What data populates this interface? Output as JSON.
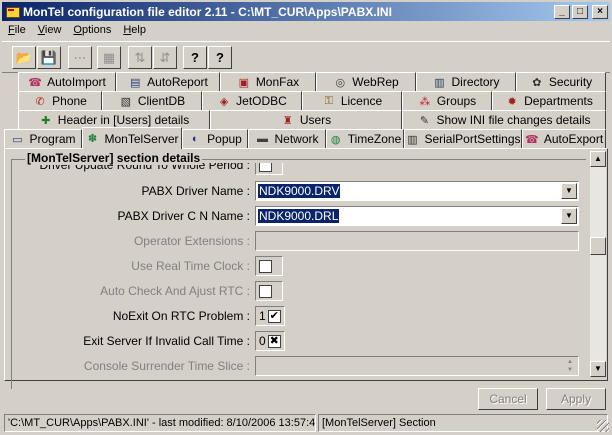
{
  "window": {
    "title": "MonTel configuration file editor 2.11  -  C:\\MT_CUR\\Apps\\PABX.INI",
    "min": "_",
    "max": "□",
    "close": "×"
  },
  "menu": [
    {
      "label": "File",
      "key": "F",
      "rest": "ile"
    },
    {
      "label": "View",
      "key": "V",
      "rest": "iew"
    },
    {
      "label": "Options",
      "key": "O",
      "rest": "ptions"
    },
    {
      "label": "Help",
      "key": "H",
      "rest": "elp"
    }
  ],
  "toolbar": {
    "open": "📂",
    "save": "💾",
    "tb3": "⋯",
    "tb4": "▦",
    "tb5": "⇅",
    "tb6": "⇵",
    "help": "?",
    "help_cursor": "?"
  },
  "tabs": {
    "row1": [
      {
        "label": "AutoImport",
        "icon": "tab-autoimport-icon",
        "glyph": "☎"
      },
      {
        "label": "AutoReport",
        "icon": "tab-autoreport-icon",
        "glyph": "▤"
      },
      {
        "label": "MonFax",
        "icon": "tab-monfax-icon",
        "glyph": "▣"
      },
      {
        "label": "WebRep",
        "icon": "tab-webrep-icon",
        "glyph": "◎"
      },
      {
        "label": "Directory",
        "icon": "tab-directory-icon",
        "glyph": "▥"
      },
      {
        "label": "Security",
        "icon": "tab-security-icon",
        "glyph": "✿"
      }
    ],
    "row2": [
      {
        "label": "Phone",
        "icon": "tab-phone-icon",
        "glyph": "✆"
      },
      {
        "label": "ClientDB",
        "icon": "tab-clientdb-icon",
        "glyph": "▧"
      },
      {
        "label": "JetODBC",
        "icon": "tab-jetodbc-icon",
        "glyph": "◈"
      },
      {
        "label": "Licence",
        "icon": "tab-licence-icon",
        "glyph": "⚿"
      },
      {
        "label": "Groups",
        "icon": "tab-groups-icon",
        "glyph": "⁂"
      },
      {
        "label": "Departments",
        "icon": "tab-departments-icon",
        "glyph": "✹"
      }
    ],
    "row3": [
      {
        "label": "Header in [Users] details",
        "icon": "tab-header-users-icon",
        "glyph": "✚"
      },
      {
        "label": "Users",
        "icon": "tab-users-icon",
        "glyph": "♜"
      },
      {
        "label": "Show INI file changes details",
        "icon": "tab-show-ini-icon",
        "glyph": "✎"
      }
    ],
    "row4": [
      {
        "label": "Program",
        "icon": "tab-program-icon",
        "glyph": "▭"
      },
      {
        "label": "MonTelServer",
        "icon": "tab-montelserver-icon",
        "glyph": "✽"
      },
      {
        "label": "Popup",
        "icon": "tab-popup-icon",
        "glyph": "◐"
      },
      {
        "label": "Network",
        "icon": "tab-network-icon",
        "glyph": "▬"
      },
      {
        "label": "TimeZone",
        "icon": "tab-timezone-icon",
        "glyph": "◍"
      },
      {
        "label": "SerialPortSettings",
        "icon": "tab-serialport-icon",
        "glyph": "▥"
      },
      {
        "label": "AutoExport",
        "icon": "tab-autoexport-icon",
        "glyph": "☎"
      }
    ]
  },
  "section": {
    "title": "[MonTelServer] section details",
    "clipped_label": "Driver Update Round To Whole Period :",
    "fields": {
      "pabx_driver": {
        "label": "PABX Driver Name :",
        "value": "NDK9000.DRV"
      },
      "pabx_driver_cn": {
        "label": "PABX Driver C N Name :",
        "value": "NDK9000.DRL"
      },
      "operator_ext": {
        "label": "Operator Extensions :",
        "value": ""
      },
      "real_time_clock": {
        "label": "Use Real Time Clock :",
        "value": ""
      },
      "auto_check_rtc": {
        "label": "Auto Check And Ajust RTC :",
        "value": ""
      },
      "noexit_rtc": {
        "label": "NoExit On RTC Problem :",
        "value": "1",
        "mark": "✔"
      },
      "exit_invalid_time": {
        "label": "Exit Server If Invalid Call Time :",
        "value": "0",
        "mark": "✖"
      },
      "console_slice": {
        "label": "Console Surrender Time Slice :",
        "value": ""
      }
    }
  },
  "buttons": {
    "cancel": "Cancel",
    "apply": "Apply"
  },
  "status": {
    "file": "'C:\\MT_CUR\\Apps\\PABX.INI' - last modified: 8/10/2006 13:57:47",
    "section": "[MonTelServer] Section"
  }
}
